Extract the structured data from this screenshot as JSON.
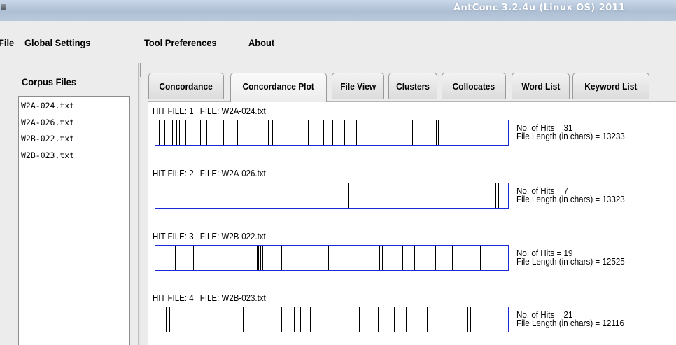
{
  "window": {
    "title": "AntConc 3.2.4u (Linux OS) 2011"
  },
  "menu": [
    "File",
    "Global Settings",
    "Tool Preferences",
    "About"
  ],
  "sidebar": {
    "label": "Corpus Files",
    "files": [
      "W2A-024.txt",
      "W2A-026.txt",
      "W2B-022.txt",
      "W2B-023.txt"
    ]
  },
  "tabs": [
    {
      "label": "Concordance",
      "active": false
    },
    {
      "label": "Concordance Plot",
      "active": true
    },
    {
      "label": "File View",
      "active": false
    },
    {
      "label": "Clusters",
      "active": false
    },
    {
      "label": "Collocates",
      "active": false
    },
    {
      "label": "Word List",
      "active": false
    },
    {
      "label": "Keyword List",
      "active": false
    }
  ],
  "plots": [
    {
      "hit_file_label": "HIT FILE: 1",
      "file_label": "FILE: W2A-024.txt",
      "hits_text": "No. of Hits = 31",
      "length_text": "File Length (in chars) = 13233",
      "hit_positions": [
        0.009,
        0.026,
        0.038,
        0.048,
        0.06,
        0.067,
        0.085,
        0.118,
        0.128,
        0.138,
        0.145,
        0.193,
        0.233,
        0.263,
        0.282,
        0.311,
        0.321,
        0.333,
        0.434,
        0.478,
        0.503,
        0.534,
        0.536,
        0.571,
        0.614,
        0.713,
        0.729,
        0.759,
        0.797,
        0.803,
        0.972
      ]
    },
    {
      "hit_file_label": "HIT FILE: 2",
      "file_label": "FILE: W2A-026.txt",
      "hits_text": "No. of Hits = 7",
      "length_text": "File Length (in chars) = 13323",
      "hit_positions": [
        0.549,
        0.555,
        0.773,
        0.944,
        0.953,
        0.966,
        0.975
      ]
    },
    {
      "hit_file_label": "HIT FILE: 3",
      "file_label": "FILE: W2B-022.txt",
      "hits_text": "No. of Hits = 19",
      "length_text": "File Length (in chars) = 12525",
      "hit_positions": [
        0.055,
        0.107,
        0.289,
        0.293,
        0.299,
        0.305,
        0.311,
        0.357,
        0.491,
        0.586,
        0.607,
        0.637,
        0.645,
        0.702,
        0.735,
        0.773,
        0.795,
        0.842,
        0.923
      ]
    },
    {
      "hit_file_label": "HIT FILE: 4",
      "file_label": "FILE: W2B-023.txt",
      "hits_text": "No. of Hits = 21",
      "length_text": "File Length (in chars) = 12116",
      "hit_positions": [
        0.03,
        0.04,
        0.248,
        0.311,
        0.358,
        0.394,
        0.412,
        0.44,
        0.578,
        0.587,
        0.595,
        0.6,
        0.607,
        0.632,
        0.677,
        0.711,
        0.719,
        0.772,
        0.887,
        0.895,
        0.905
      ]
    }
  ],
  "colors": {
    "plot_border": "#1a2bd6",
    "hit_line": "#000000"
  }
}
